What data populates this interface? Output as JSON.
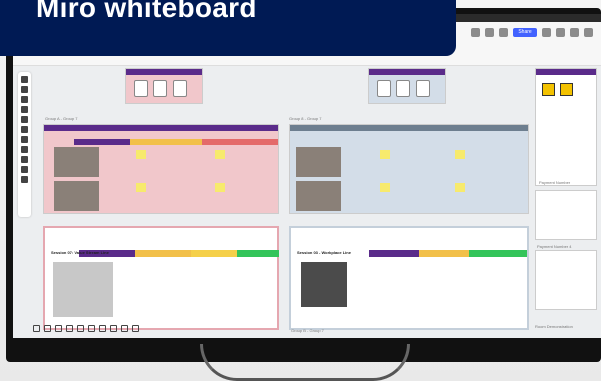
{
  "banner": {
    "title": "Miro whiteboard"
  },
  "topbar": {
    "share_label": "Share"
  },
  "canvas": {
    "group_a_label": "Group A - Group 7",
    "group_b_label": "Group 8 - Group 7",
    "session_a_title": "Session 07: Value Stream Line",
    "session_b_title": "Session 03 - Workplace Line",
    "step_numbers": [
      "1",
      "2",
      "3"
    ],
    "right_panel_title": "Payment Number",
    "right_panel_title_2": "Payment Number 4",
    "bottom_right_label": "Room Demonstration",
    "bottom_center_label": "Group B - Group 7"
  },
  "colors": {
    "banner": "#001a54",
    "share": "#4262ff",
    "board_header": "#5a2b8a",
    "sticky": "#f7ea6d"
  }
}
